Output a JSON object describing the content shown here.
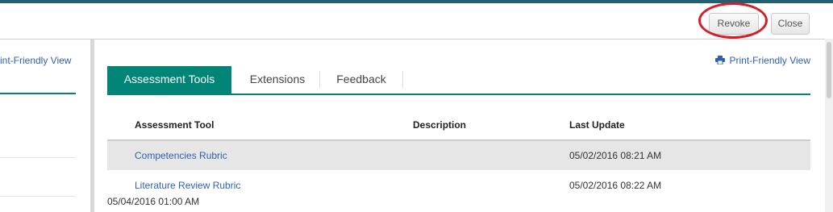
{
  "header": {
    "revoke_label": "Revoke",
    "close_label": "Close"
  },
  "left_panel": {
    "print_link": "rint-Friendly View"
  },
  "main": {
    "print_link": "Print-Friendly View",
    "tabs": [
      {
        "label": "Assessment Tools",
        "active": true
      },
      {
        "label": "Extensions",
        "active": false
      },
      {
        "label": "Feedback",
        "active": false
      }
    ],
    "table": {
      "columns": [
        "Assessment Tool",
        "Description",
        "Last Update"
      ],
      "rows": [
        {
          "tool": "Competencies Rubric",
          "description": "",
          "last_update": "05/02/2016 08:21 AM"
        },
        {
          "tool": "Literature Review Rubric",
          "description": "",
          "last_update": "05/02/2016 08:22 AM"
        }
      ],
      "footer_date": "05/04/2016 01:00 AM"
    }
  },
  "colors": {
    "accent": "#008577",
    "link": "#2f5fb3",
    "highlight": "#d0202a",
    "top_stripe": "#1f5f6e"
  },
  "icons": {
    "printer": "printer-icon"
  }
}
